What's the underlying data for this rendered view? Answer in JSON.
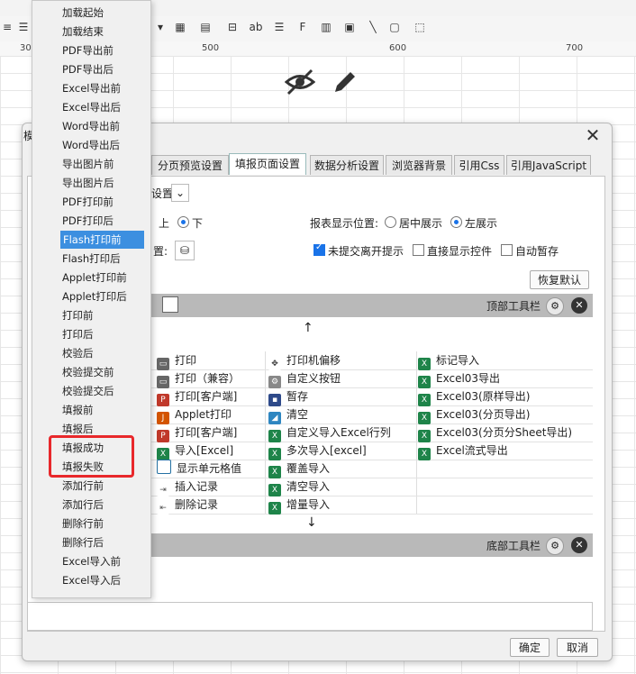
{
  "ruler": {
    "ticks": [
      "300",
      "500",
      "600",
      "700"
    ]
  },
  "dialog": {
    "title": "模",
    "tabs": [
      "分页预览设置",
      "填报页面设置",
      "数据分析设置",
      "浏览器背景",
      "引用Css",
      "引用JavaScript"
    ],
    "active_tab": "填报页面设置",
    "partial_setting_label": "设置",
    "position_up": "上",
    "position_down": "下",
    "position_selected": "下",
    "set_label": "置:",
    "report_position_label": "报表显示位置:",
    "center_show": "居中展示",
    "left_show": "左展示",
    "left_show_selected": true,
    "unsubmitted_leave_prompt": "未提交离开提示",
    "unsubmitted_leave_prompt_checked": true,
    "direct_show_control": "直接显示控件",
    "direct_show_control_checked": false,
    "auto_save": "自动暂存",
    "auto_save_checked": false,
    "restore_default": "恢复默认",
    "top_toolbar": "顶部工具栏",
    "bottom_toolbar": "底部工具栏",
    "ok": "确定",
    "cancel": "取消",
    "up_arrow": "↑",
    "down_arrow": "↓"
  },
  "grid": {
    "col1": [
      "打印",
      "打印（兼容）",
      "打印[客户端]",
      "Applet打印",
      "打印[客户端]",
      "导入[Excel]",
      "显示单元格值",
      "插入记录",
      "删除记录"
    ],
    "col2": [
      "打印机偏移",
      "自定义按钮",
      "暂存",
      "清空",
      "自定义导入Excel行列",
      "多次导入[excel]",
      "覆盖导入",
      "清空导入",
      "增量导入"
    ],
    "col3": [
      "标记导入",
      "Excel03导出",
      "Excel03(原样导出)",
      "Excel03(分页导出)",
      "Excel03(分页分Sheet导出)",
      "Excel流式导出"
    ]
  },
  "menu": {
    "items": [
      "加载起始",
      "加载结束",
      "PDF导出前",
      "PDF导出后",
      "Excel导出前",
      "Excel导出后",
      "Word导出前",
      "Word导出后",
      "导出图片前",
      "导出图片后",
      "PDF打印前",
      "PDF打印后",
      "Flash打印前",
      "Flash打印后",
      "Applet打印前",
      "Applet打印后",
      "打印前",
      "打印后",
      "校验后",
      "校验提交前",
      "校验提交后",
      "填报前",
      "填报后",
      "填报成功",
      "填报失败",
      "添加行前",
      "添加行后",
      "删除行前",
      "删除行后",
      "Excel导入前",
      "Excel导入后"
    ],
    "selected": "Flash打印前"
  },
  "colors": {
    "accent": "#3c8fe0",
    "highlight": "#e8282b",
    "bar": "#b9b9b9"
  }
}
